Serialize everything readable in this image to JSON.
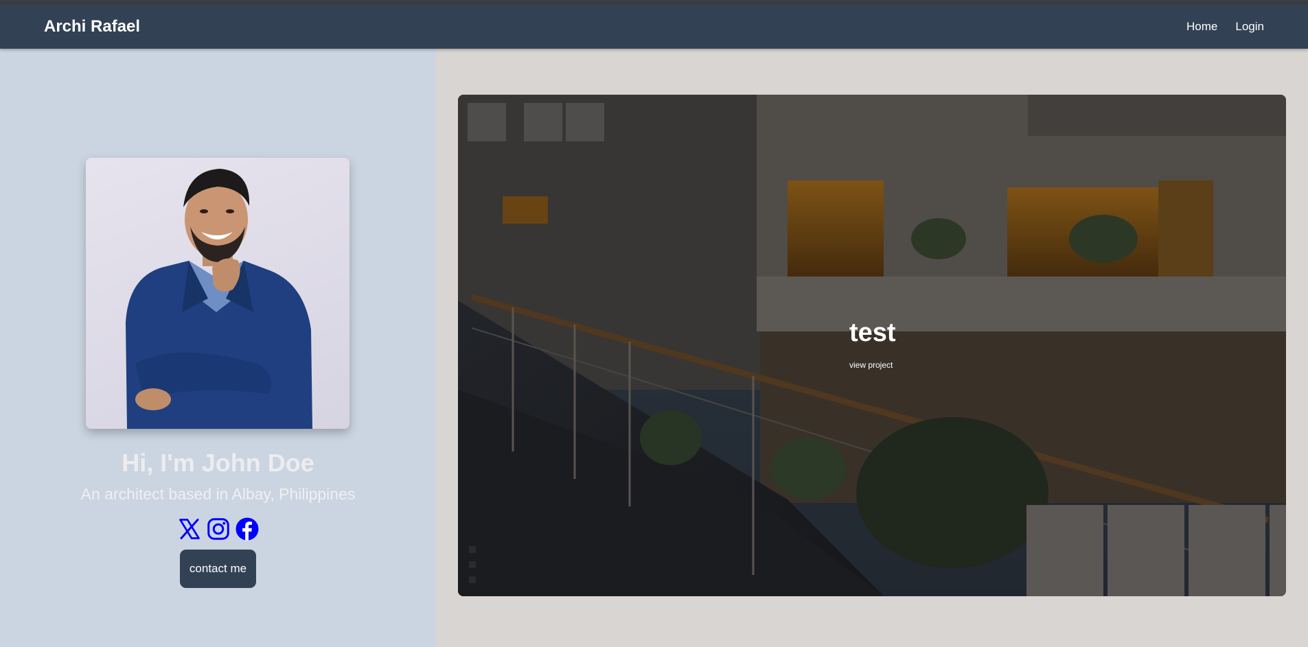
{
  "navbar": {
    "brand": "Archi Rafael",
    "links": [
      "Home",
      "Login"
    ]
  },
  "profile": {
    "heading": "Hi, I'm John Doe",
    "subtitle": "An architect based in Albay, Philippines",
    "contact_label": "contact me",
    "socials": [
      "x-icon",
      "instagram-icon",
      "facebook-icon"
    ],
    "social_color": "#0000ff"
  },
  "project": {
    "title": "test",
    "link_label": "view project"
  },
  "colors": {
    "navbar": "#334155",
    "left_panel": "#cbd5e1",
    "right_panel": "#d9d5d2",
    "button": "#334155"
  }
}
